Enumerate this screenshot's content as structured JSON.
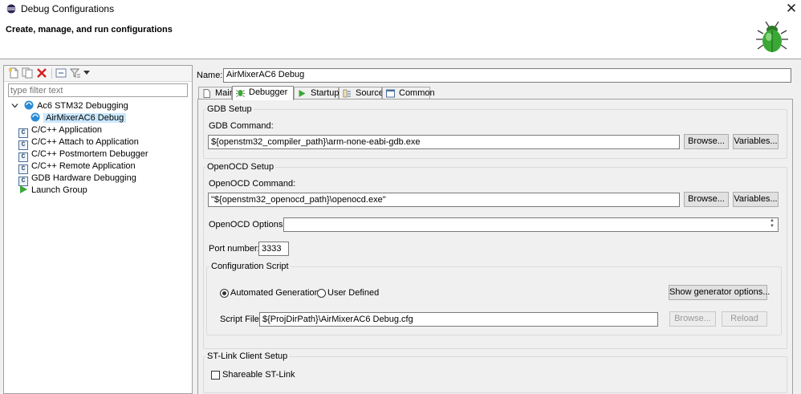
{
  "window": {
    "title": "Debug Configurations",
    "close_glyph": "✕"
  },
  "header": {
    "heading": "Create, manage, and run configurations"
  },
  "sidebar": {
    "filter_placeholder": "type filter text",
    "tree": [
      {
        "label": "Ac6 STM32 Debugging",
        "icon": "ac6-debug-icon",
        "expanded": true
      },
      {
        "label": "AirMixerAC6 Debug",
        "icon": "ac6-config-icon",
        "selected": true
      },
      {
        "label": "C/C++ Application",
        "icon": "c-app-icon"
      },
      {
        "label": "C/C++ Attach to Application",
        "icon": "c-app-icon"
      },
      {
        "label": "C/C++ Postmortem Debugger",
        "icon": "c-app-icon"
      },
      {
        "label": "C/C++ Remote Application",
        "icon": "c-app-icon"
      },
      {
        "label": "GDB Hardware Debugging",
        "icon": "c-app-icon"
      },
      {
        "label": "Launch Group",
        "icon": "launch-group-icon"
      }
    ],
    "c_icon_glyph": "C"
  },
  "config": {
    "name_label": "Name:",
    "name_value": "AirMixerAC6 Debug",
    "tabs": [
      {
        "label": "Main",
        "icon": "main-tab-icon"
      },
      {
        "label": "Debugger",
        "icon": "debugger-tab-icon",
        "active": true
      },
      {
        "label": "Startup",
        "icon": "startup-tab-icon"
      },
      {
        "label": "Source",
        "icon": "source-tab-icon"
      },
      {
        "label": "Common",
        "icon": "common-tab-icon"
      }
    ]
  },
  "gdb": {
    "section": "GDB Setup",
    "command_label": "GDB Command:",
    "command_value": "${openstm32_compiler_path}\\arm-none-eabi-gdb.exe",
    "browse": "Browse...",
    "variables": "Variables..."
  },
  "openocd": {
    "section": "OpenOCD Setup",
    "command_label": "OpenOCD Command:",
    "command_value": "\"${openstm32_openocd_path}\\openocd.exe\"",
    "browse": "Browse...",
    "variables": "Variables...",
    "options_label": "OpenOCD Options :",
    "options_value": "",
    "port_label": "Port number:",
    "port_value": "3333"
  },
  "config_script": {
    "section": "Configuration Script",
    "automated_label": "Automated Generation",
    "user_defined_label": "User Defined",
    "selected": "automated",
    "show_generator": "Show generator options...",
    "script_file_label": "Script File:",
    "script_file_value": "${ProjDirPath}\\AirMixerAC6 Debug.cfg",
    "browse": "Browse...",
    "reload": "Reload"
  },
  "stlink": {
    "section": "ST-Link Client Setup",
    "shareable_label": "Shareable ST-Link",
    "shareable_checked": false
  },
  "colors": {
    "selection": "#cce8ff",
    "bug_green": "#3aa835",
    "ac6_blue": "#2a8ad4"
  }
}
